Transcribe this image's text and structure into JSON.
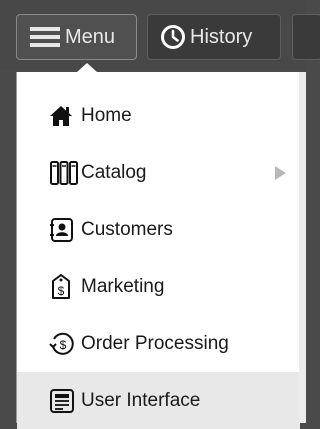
{
  "topbar": {
    "menu_label": "Menu",
    "history_label": "History"
  },
  "menu": {
    "items": [
      {
        "label": "Home",
        "icon": "home-icon"
      },
      {
        "label": "Catalog",
        "icon": "catalog-icon",
        "submenu": true
      },
      {
        "label": "Customers",
        "icon": "customers-icon"
      },
      {
        "label": "Marketing",
        "icon": "marketing-icon"
      },
      {
        "label": "Order Processing",
        "icon": "order-processing-icon"
      },
      {
        "label": "User Interface",
        "icon": "user-interface-icon",
        "highlighted": true
      }
    ]
  },
  "colors": {
    "topbar_bg": "#484848",
    "panel_bg": "#ffffff",
    "highlight_bg": "#e8e8e8"
  }
}
